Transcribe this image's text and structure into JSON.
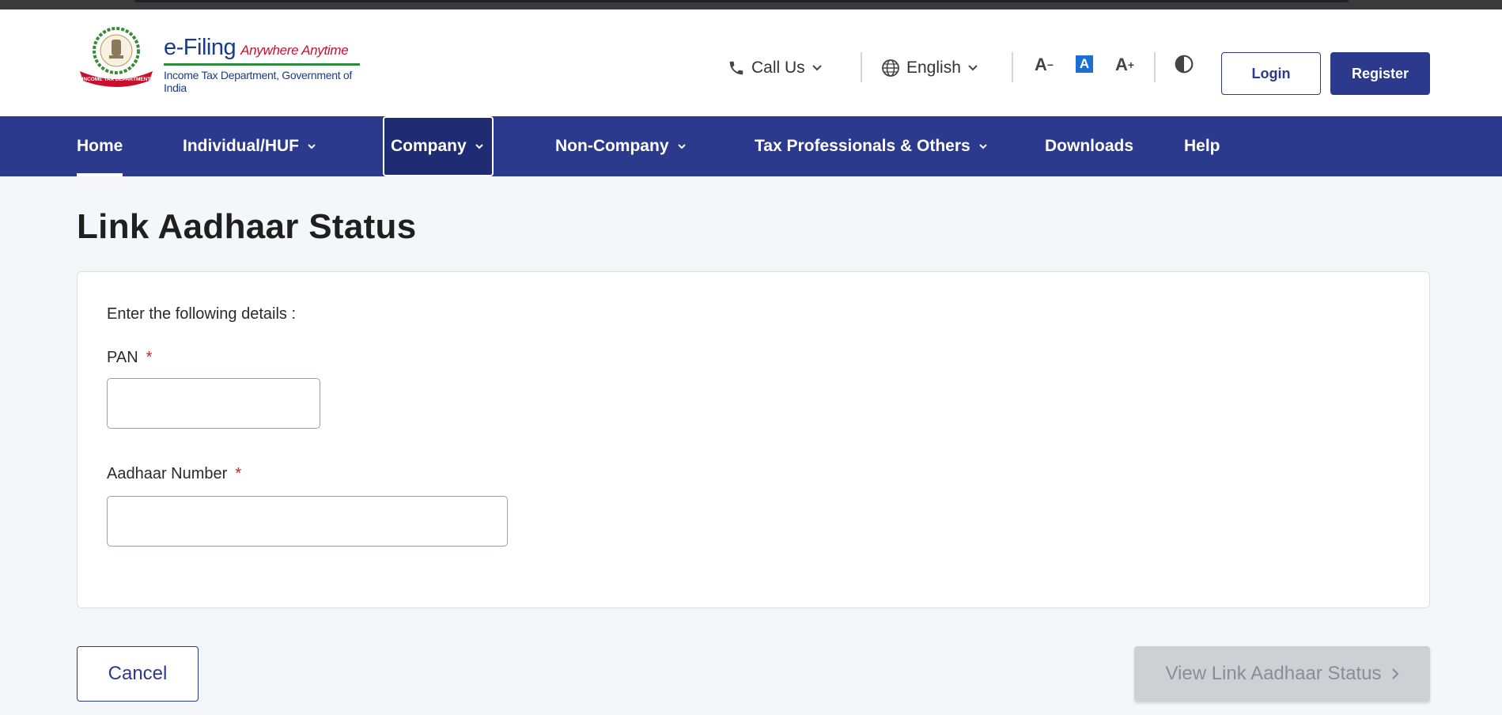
{
  "header": {
    "logo": {
      "name": "e-Filing",
      "tagline": "Anywhere Anytime",
      "department": "Income Tax Department, Government of India",
      "emblem_text": "INCOME TAX DEPARTMENT"
    },
    "call_us_label": "Call Us",
    "language_label": "English",
    "font_decrease_label": "A",
    "font_default_label": "A",
    "font_increase_label": "A",
    "login_label": "Login",
    "register_label": "Register"
  },
  "nav": {
    "items": [
      {
        "label": "Home"
      },
      {
        "label": "Individual/HUF"
      },
      {
        "label": "Company"
      },
      {
        "label": "Non-Company"
      },
      {
        "label": "Tax Professionals & Others"
      },
      {
        "label": "Downloads"
      },
      {
        "label": "Help"
      }
    ]
  },
  "page": {
    "title": "Link Aadhaar Status",
    "intro": "Enter the following details :",
    "pan_label": "PAN",
    "pan_value": "",
    "aadhaar_label": "Aadhaar Number",
    "aadhaar_value": "",
    "required_marker": "*",
    "cancel_label": "Cancel",
    "view_label": "View Link Aadhaar Status"
  },
  "colors": {
    "primary": "#2b3a8c",
    "required": "#c62828",
    "disabled_bg": "#cfd0d4"
  }
}
